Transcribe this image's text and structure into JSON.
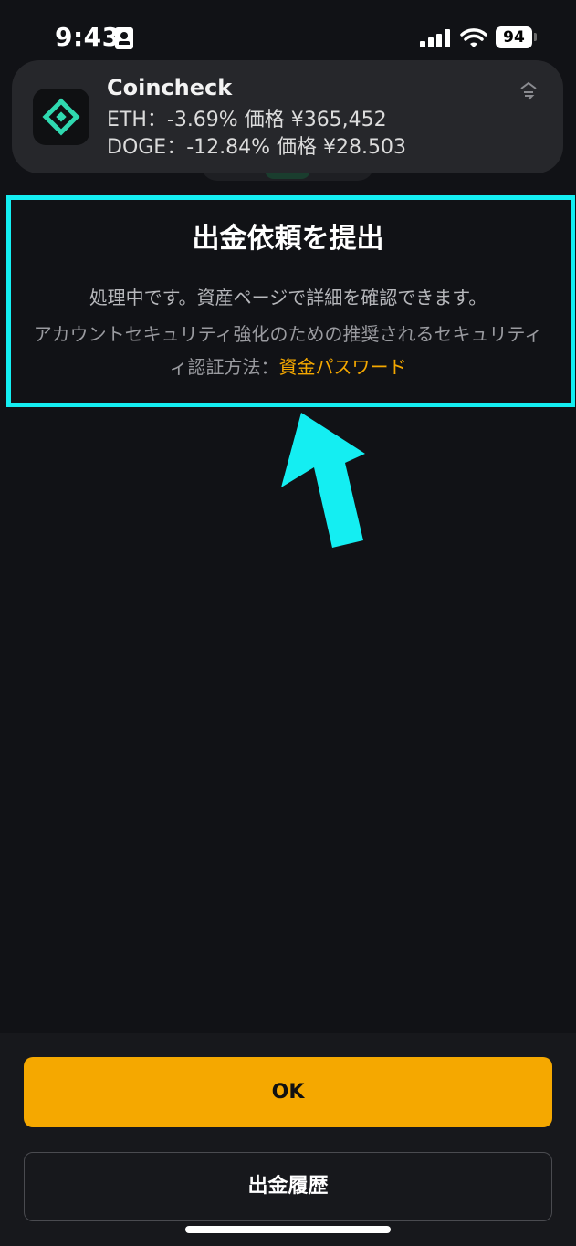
{
  "status_bar": {
    "time": "9:43",
    "battery": "94"
  },
  "notification": {
    "app_name": "Coincheck",
    "line1": "ETH：-3.69% 価格 ¥365,452",
    "line2": "DOGE：-12.84% 価格 ¥28.503",
    "icon_color": "#2fd9b0"
  },
  "dialog": {
    "title": "出金依頼を提出",
    "message": "処理中です。資産ページで詳細を確認できます。",
    "security_line1": "アカウントセキュリティ強化のための推奨されるセキュリティ",
    "security_line2_prefix": "ィ認証方法：",
    "security_link": "資金パスワード"
  },
  "buttons": {
    "ok": "OK",
    "history": "出金履歴"
  },
  "colors": {
    "accent": "#f5a800",
    "highlight": "#14eef2",
    "background": "#111216"
  }
}
